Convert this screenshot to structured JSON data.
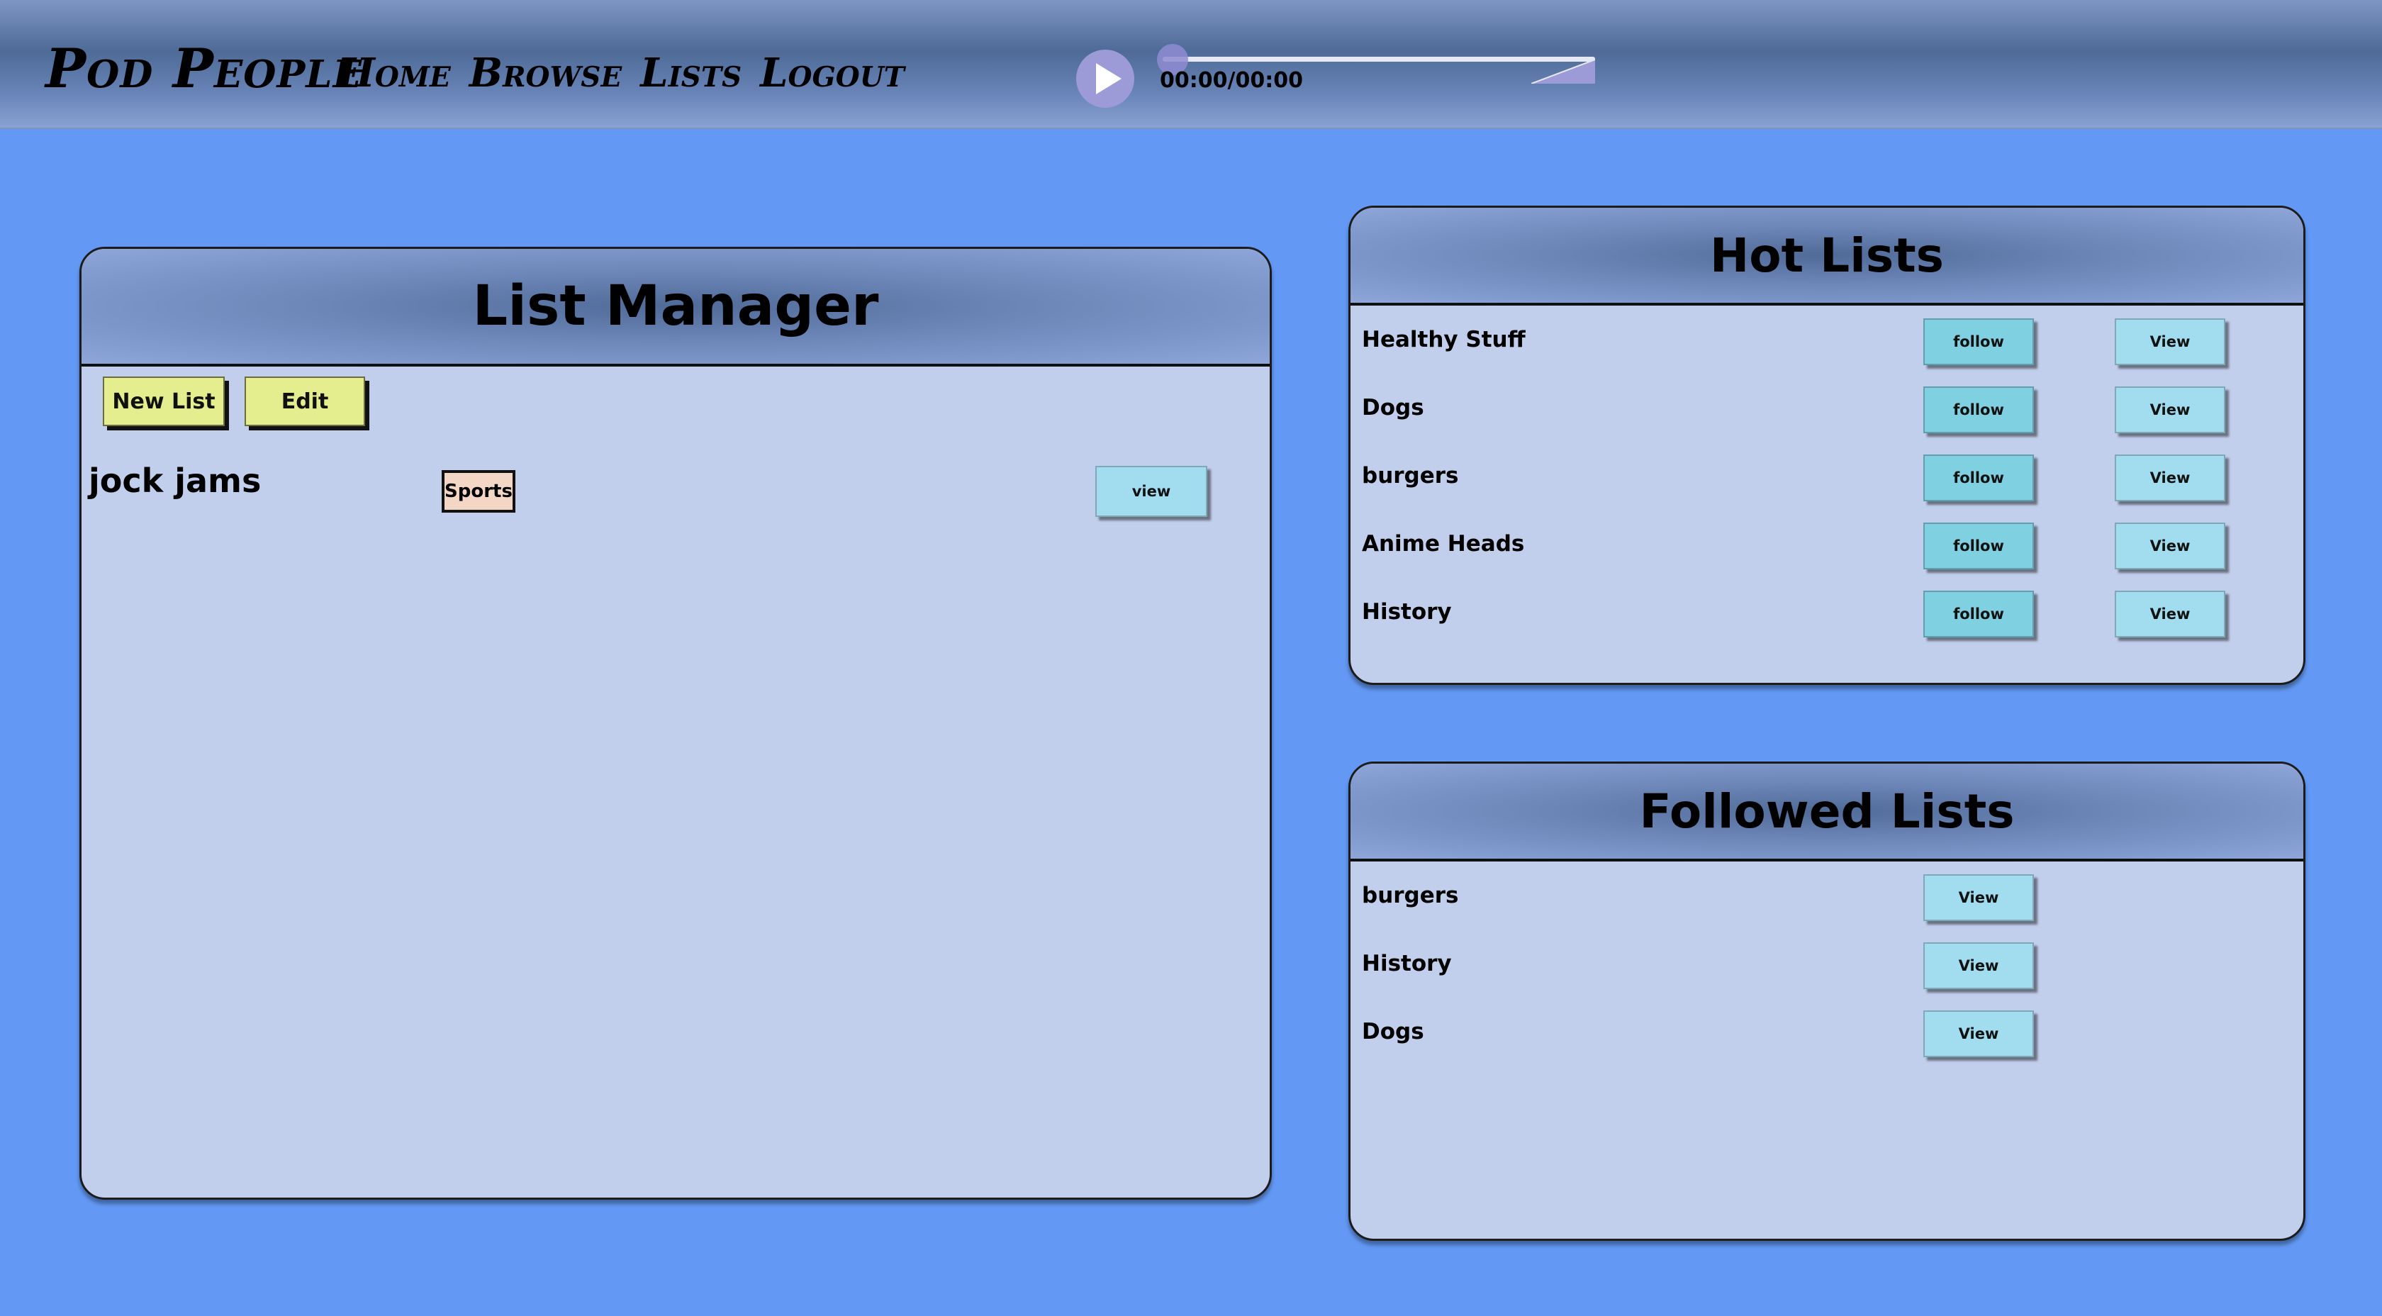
{
  "header": {
    "brand": "Pod People",
    "nav": [
      "Home",
      "Browse",
      "Lists",
      "Logout"
    ],
    "player": {
      "time": "00:00/00:00",
      "progress": 0
    }
  },
  "list_manager": {
    "title": "List Manager",
    "new_list_label": "New List",
    "edit_label": "Edit",
    "lists": [
      {
        "name": "jock jams",
        "tag": "Sports",
        "view_label": "view"
      }
    ]
  },
  "hot_lists": {
    "title": "Hot Lists",
    "follow_label": "follow",
    "view_label": "View",
    "items": [
      "Healthy Stuff",
      "Dogs",
      "burgers",
      "Anime Heads",
      "History"
    ]
  },
  "followed_lists": {
    "title": "Followed Lists",
    "view_label": "View",
    "items": [
      "burgers",
      "History",
      "Dogs"
    ]
  },
  "colors": {
    "background": "#6399f5",
    "panel": "#c2cfec",
    "yellow_button": "#e5ee8e",
    "follow_button": "#7fd0e0",
    "view_button": "#a2dcef",
    "tag": "#f3d6c3"
  }
}
